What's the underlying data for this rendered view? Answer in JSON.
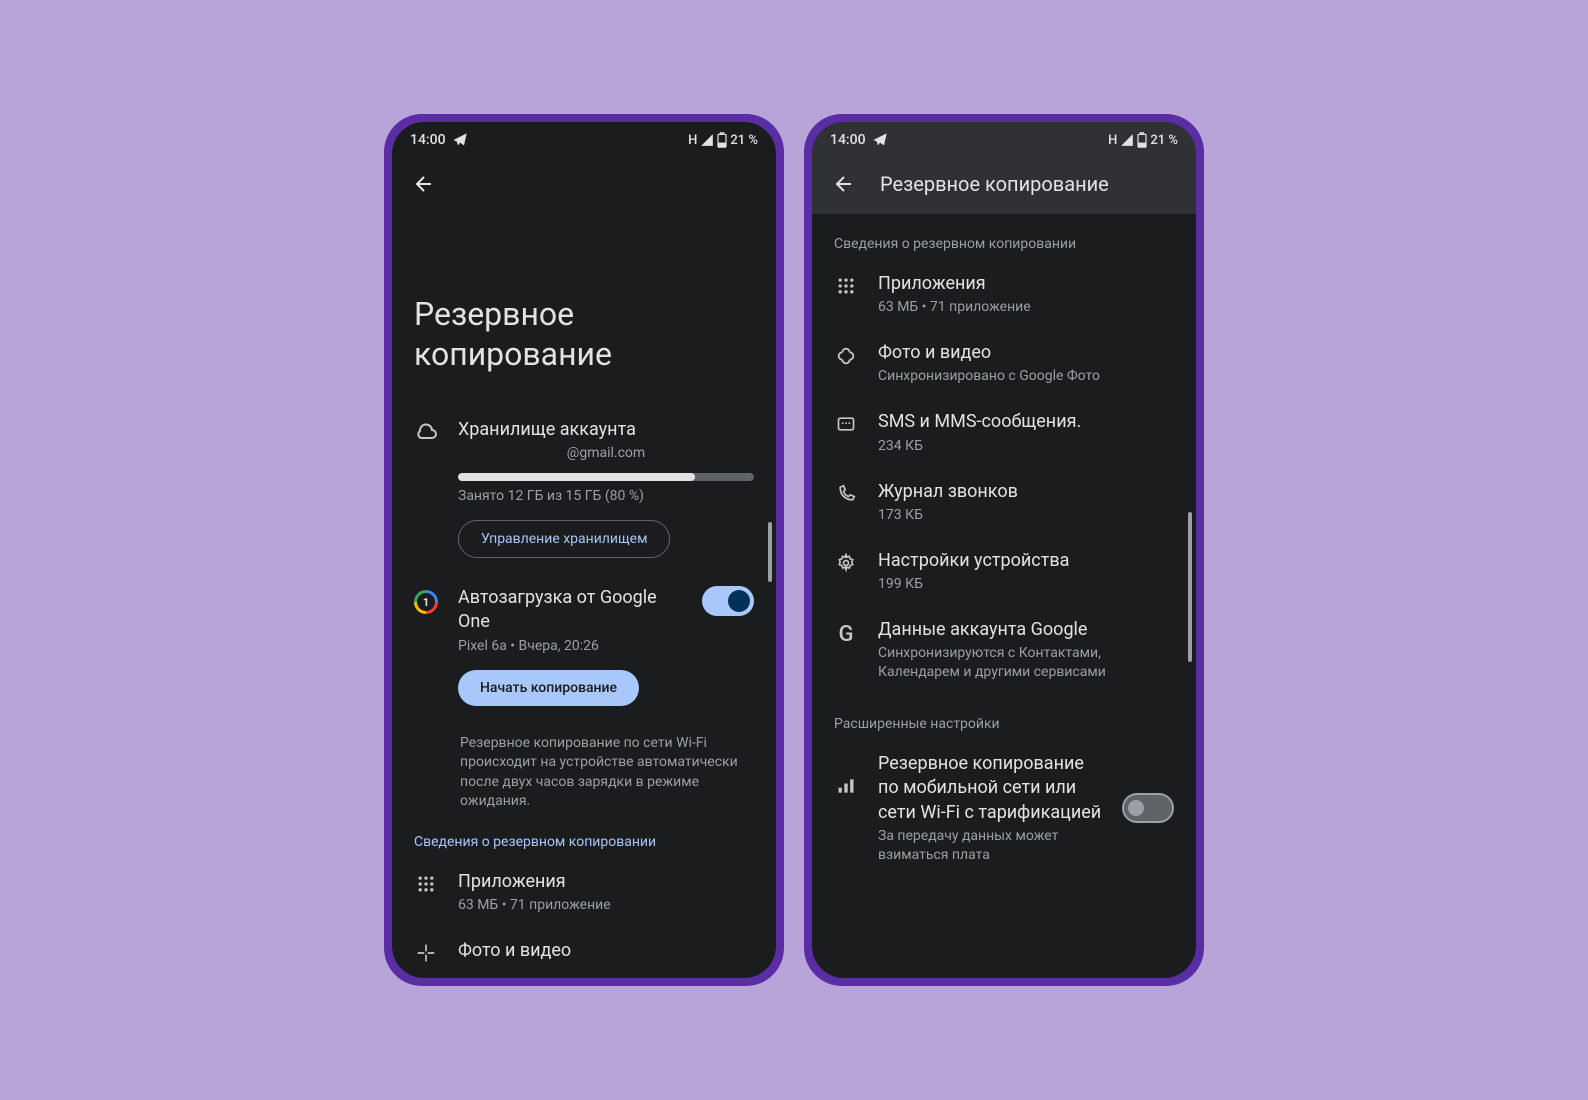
{
  "status": {
    "time": "14:00",
    "network": "H",
    "battery": "21 %"
  },
  "screen1": {
    "title": "Резервное копирование",
    "storage": {
      "title": "Хранилище аккаунта",
      "email": "@gmail.com",
      "usage_text": "Занято 12 ГБ из 15 ГБ (80 %)",
      "usage_percent": 80,
      "manage_button": "Управление хранилищем"
    },
    "autoload": {
      "title": "Автозагрузка от Google One",
      "subtitle": "Pixel 6a • Вчера, 20:26",
      "enabled": true,
      "start_button": "Начать копирование",
      "help": "Резервное копирование по сети Wi-Fi происходит на устройстве автоматически после двух часов зарядки в режиме ожидания."
    },
    "details_header": "Сведения о резервном копировании",
    "items": [
      {
        "title": "Приложения",
        "subtitle": "63 МБ • 71 приложение"
      },
      {
        "title": "Фото и видео",
        "subtitle": ""
      }
    ]
  },
  "screen2": {
    "header_title": "Резервное копирование",
    "details_header": "Сведения о резервном копировании",
    "items": [
      {
        "title": "Приложения",
        "subtitle": "63 МБ • 71 приложение"
      },
      {
        "title": "Фото и видео",
        "subtitle": "Синхронизировано с Google Фото"
      },
      {
        "title": "SMS и MMS-сообщения.",
        "subtitle": "234 КБ"
      },
      {
        "title": "Журнал звонков",
        "subtitle": "173 КБ"
      },
      {
        "title": "Настройки устройства",
        "subtitle": "199 КБ"
      },
      {
        "title": "Данные аккаунта Google",
        "subtitle": "Синхронизируются с Контактами, Календарем и другими сервисами"
      }
    ],
    "advanced_header": "Расширенные настройки",
    "mobile_backup": {
      "title": "Резервное копирование по мобильной сети или сети Wi-Fi с тарификацией",
      "subtitle": "За передачу данных может взиматься плата",
      "enabled": false
    }
  }
}
